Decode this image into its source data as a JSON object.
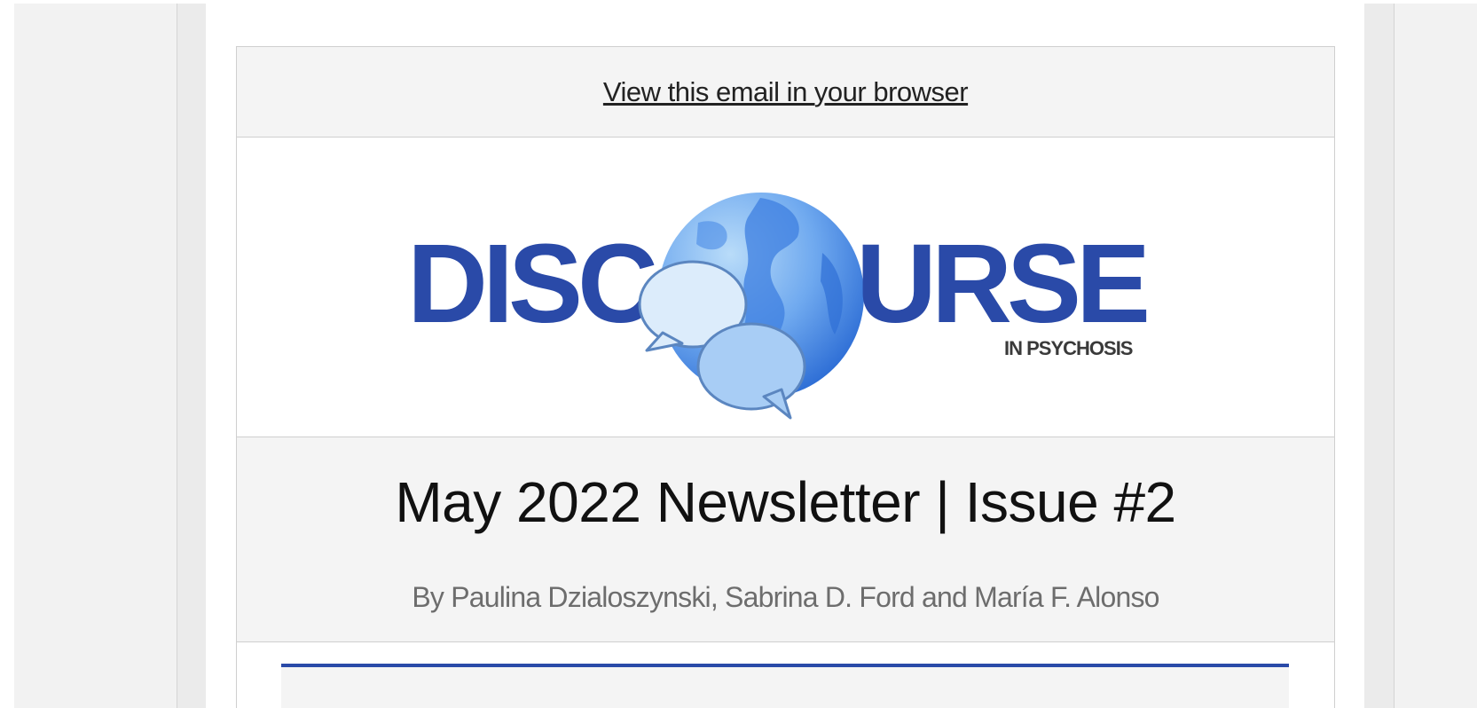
{
  "email": {
    "view_in_browser": "View this email in your browser",
    "logo": {
      "word_left": "DISC",
      "word_right": "URSE",
      "tagline": "IN PSYCHOSIS"
    },
    "title": "May 2022 Newsletter | Issue #2",
    "byline": "By Paulina Dzialoszynski, Sabrina D. Ford and María F. Alonso"
  },
  "colors": {
    "brand_blue": "#2a4aa8",
    "tagline_gray": "#3a3a3a",
    "globe_light": "#9cc8f2",
    "globe_dark": "#3d7fe0",
    "panel_bg": "#f4f4f4"
  },
  "icons": [
    "globe-icon",
    "speech-bubble-icon"
  ]
}
